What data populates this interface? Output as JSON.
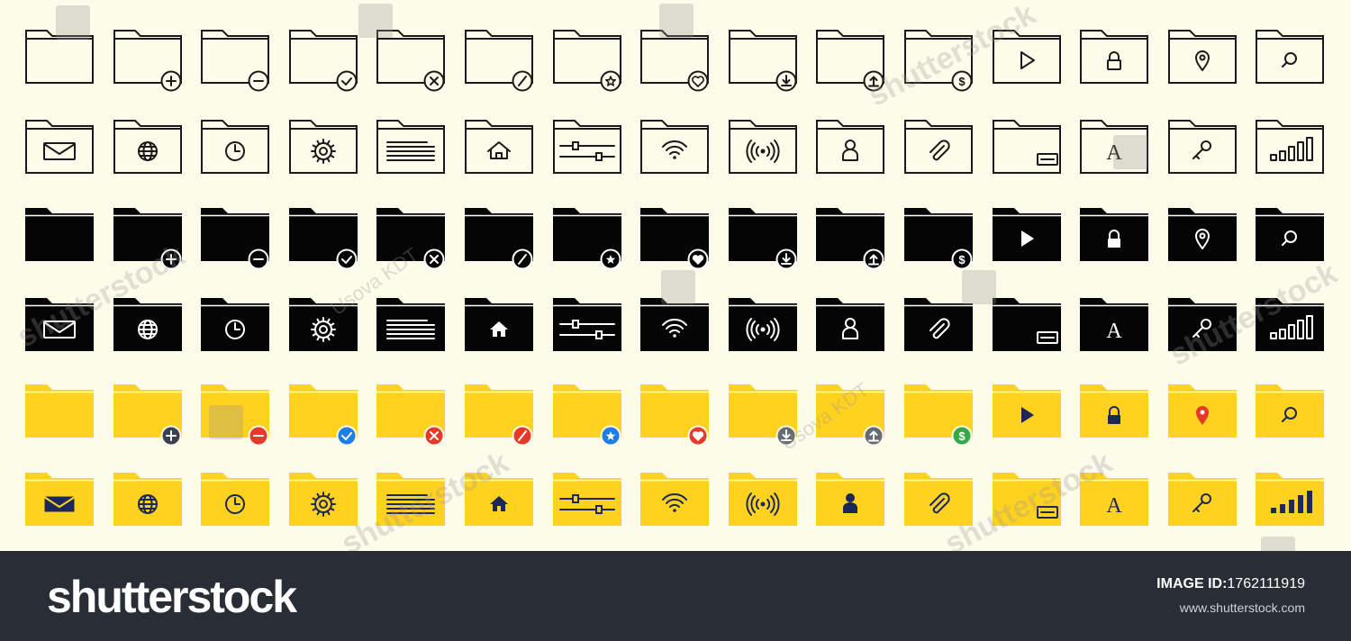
{
  "palette": {
    "background": "#fdfbe9",
    "outline": "#1a1a1a",
    "solid": "#050505",
    "yellow": "#ffd21f",
    "navy": "#1c2859",
    "footer": "#292d36"
  },
  "rows": [
    {
      "style": "outline",
      "icons": [
        "folder-plain-icon",
        "folder-add-icon",
        "folder-remove-icon",
        "folder-check-icon",
        "folder-delete-icon",
        "folder-blocked-icon",
        "folder-star-icon",
        "folder-heart-icon",
        "folder-download-icon",
        "folder-upload-icon",
        "folder-dollar-icon",
        "folder-play-icon",
        "folder-lock-icon",
        "folder-location-icon",
        "folder-search-icon"
      ]
    },
    {
      "style": "outline",
      "icons": [
        "folder-mail-icon",
        "folder-globe-icon",
        "folder-clock-icon",
        "folder-settings-icon",
        "folder-document-icon",
        "folder-home-icon",
        "folder-sliders-icon",
        "folder-wifi-icon",
        "folder-broadcast-icon",
        "folder-user-icon",
        "folder-attachment-icon",
        "folder-card-icon",
        "folder-font-icon",
        "folder-key-icon",
        "folder-signal-icon"
      ]
    },
    {
      "style": "solid",
      "icons": [
        "folder-plain-icon",
        "folder-add-icon",
        "folder-remove-icon",
        "folder-check-icon",
        "folder-delete-icon",
        "folder-blocked-icon",
        "folder-star-icon",
        "folder-heart-icon",
        "folder-download-icon",
        "folder-upload-icon",
        "folder-dollar-icon",
        "folder-play-icon",
        "folder-lock-icon",
        "folder-location-icon",
        "folder-search-icon"
      ]
    },
    {
      "style": "solid",
      "icons": [
        "folder-mail-icon",
        "folder-globe-icon",
        "folder-clock-icon",
        "folder-settings-icon",
        "folder-document-icon",
        "folder-home-icon",
        "folder-sliders-icon",
        "folder-wifi-icon",
        "folder-broadcast-icon",
        "folder-user-icon",
        "folder-attachment-icon",
        "folder-card-icon",
        "folder-font-icon",
        "folder-key-icon",
        "folder-signal-icon"
      ]
    },
    {
      "style": "yellow",
      "icons": [
        "folder-plain-icon",
        "folder-add-icon",
        "folder-remove-icon",
        "folder-check-icon",
        "folder-delete-icon",
        "folder-blocked-icon",
        "folder-star-icon",
        "folder-heart-icon",
        "folder-download-icon",
        "folder-upload-icon",
        "folder-dollar-icon",
        "folder-play-icon",
        "folder-lock-icon",
        "folder-location-icon",
        "folder-search-icon"
      ],
      "badge_colors": {
        "add": "#3a4150",
        "remove": "#e53a2a",
        "check": "#1e7de6",
        "delete": "#e53a2a",
        "blocked": "#e53a2a",
        "star": "#1e7de6",
        "heart": "#e53a2a",
        "download": "#666a73",
        "upload": "#666a73",
        "dollar": "#35a84a"
      },
      "glyph_colors": {
        "play": "#1c2859",
        "lock": "#1c2859",
        "location": "#e53a2a",
        "search": "#1c2859"
      }
    },
    {
      "style": "yellow",
      "icons": [
        "folder-mail-icon",
        "folder-globe-icon",
        "folder-clock-icon",
        "folder-settings-icon",
        "folder-document-icon",
        "folder-home-icon",
        "folder-sliders-icon",
        "folder-wifi-icon",
        "folder-broadcast-icon",
        "folder-user-icon",
        "folder-attachment-icon",
        "folder-card-icon",
        "folder-font-icon",
        "folder-key-icon",
        "folder-signal-icon"
      ]
    }
  ],
  "watermark": {
    "brand": "shutterstock",
    "author": "Usova KDT"
  },
  "footer": {
    "brand": "shutterstock",
    "image_id_label": "IMAGE ID:",
    "image_id": "1762111919",
    "site": "www.shutterstock.com"
  }
}
